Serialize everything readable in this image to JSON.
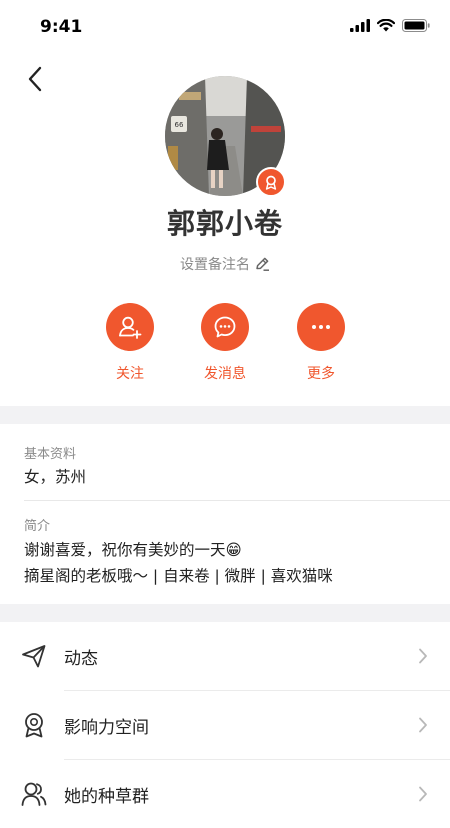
{
  "status": {
    "time": "9:41"
  },
  "profile": {
    "name": "郭郭小卷",
    "remark_label": "设置备注名"
  },
  "actions": [
    {
      "label": "关注",
      "icon": "add-user-icon"
    },
    {
      "label": "发消息",
      "icon": "chat-bubble-icon"
    },
    {
      "label": "更多",
      "icon": "more-dots-icon"
    }
  ],
  "info": {
    "basic_title": "基本资料",
    "basic_value": "女，苏州",
    "intro_title": "简介",
    "intro_line1": "谢谢喜爱，祝你有美妙的一天😁",
    "intro_line2": "摘星阁的老板哦～ | 自来卷 | 微胖 | 喜欢猫咪"
  },
  "menu": [
    {
      "label": "动态",
      "icon": "paper-plane-icon"
    },
    {
      "label": "影响力空间",
      "icon": "award-ribbon-icon"
    },
    {
      "label": "她的种草群",
      "icon": "group-users-icon"
    }
  ],
  "colors": {
    "accent": "#f0572e",
    "section_gap": "#f2f2f4"
  }
}
